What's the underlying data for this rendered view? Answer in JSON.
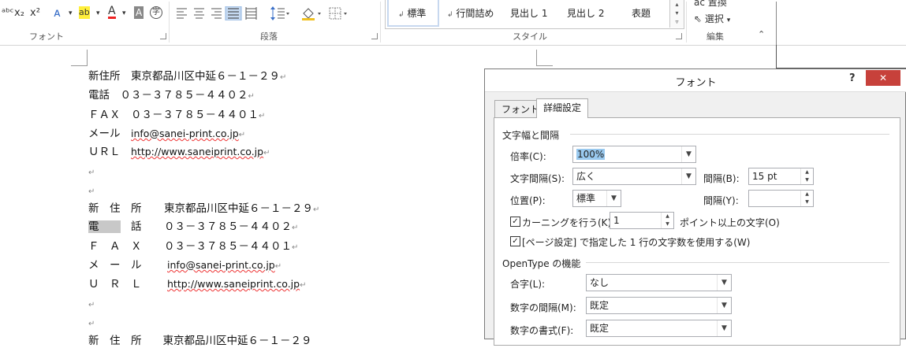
{
  "ribbon": {
    "font_tools": [
      "x₂",
      "x²"
    ],
    "font_tool_glyphs": [
      "ᴀ",
      "▾",
      "ab",
      "▾",
      "A",
      "▾",
      "A",
      "字"
    ],
    "group_font": "フォント",
    "group_paragraph": "段落",
    "group_style": "スタイル",
    "group_edit": "編集",
    "edit_replace": "ac 置換",
    "edit_select": "選択",
    "styles": [
      "標準",
      "行間詰め",
      "見出し 1",
      "見出し 2",
      "表題"
    ]
  },
  "document": {
    "block1": [
      "新住所　東京都品川区中延６－１－２９",
      "電話　０３－３７８５－４４０２",
      "ＦＡＸ　０３－３７８５－４４０１",
      "メール　",
      "ＵＲＬ　"
    ],
    "email1": "info@sanei-print.co.jp",
    "url1": "http://www.saneiprint.co.jp",
    "block2_labels": [
      "新　住　所",
      "電　　　話",
      "Ｆ　Ａ　Ｘ",
      "メ　ー　ル",
      "Ｕ　Ｒ　Ｌ"
    ],
    "block2_values": [
      "東京都品川区中延６－１－２９",
      "０３－３７８５－４４０２",
      "０３－３７８５－４４０１",
      "info@sanei-print.co.jp",
      "http://www.saneiprint.co.jp"
    ],
    "block3_partial": "新　住　所　　東京都品川区中延６－１－２９",
    "para_mark": "↵"
  },
  "dialog": {
    "title": "フォント",
    "help": "?",
    "close": "✕",
    "tabs": [
      "フォント",
      "詳細設定"
    ],
    "section_spacing": "文字幅と間隔",
    "scale_label": "倍率(C):",
    "scale_value": "100%",
    "spacing_label": "文字間隔(S):",
    "spacing_value": "広く",
    "by_label": "間隔(B):",
    "by_value": "15 pt",
    "position_label": "位置(P):",
    "position_value": "標準",
    "by2_label": "間隔(Y):",
    "by2_value": "",
    "kerning_label": "カーニングを行う(K):",
    "kerning_value": "1",
    "kerning_suffix": "ポイント以上の文字(O)",
    "grid_label": "[ページ設定] で指定した 1 行の文字数を使用する(W)",
    "section_opentype": "OpenType の機能",
    "ligatures_label": "合字(L):",
    "ligatures_value": "なし",
    "num_spacing_label": "数字の間隔(M):",
    "num_spacing_value": "既定",
    "num_forms_label": "数字の書式(F):",
    "num_forms_value": "既定"
  }
}
